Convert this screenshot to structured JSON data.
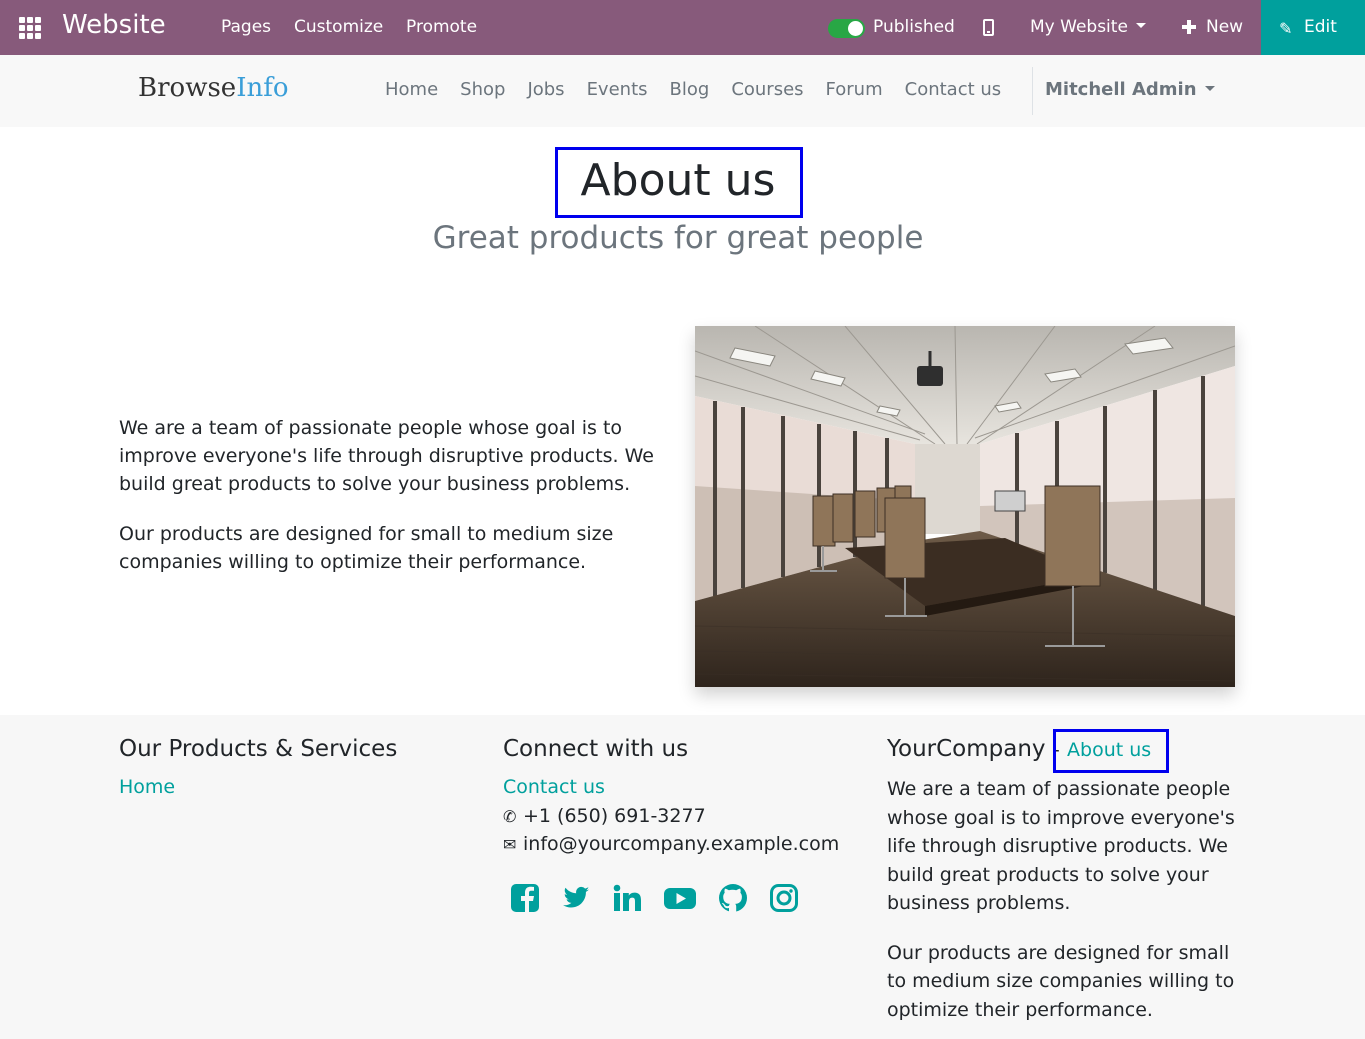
{
  "topbar": {
    "app_name": "Website",
    "menu": [
      "Pages",
      "Customize",
      "Promote"
    ],
    "published_label": "Published",
    "published_on": true,
    "website_selector": "My Website",
    "new_label": "New",
    "edit_label": "Edit",
    "colors": {
      "bar": "#875a7b",
      "edit": "#00a09d",
      "toggle": "#28a745"
    }
  },
  "header": {
    "logo_part1": "Browse",
    "logo_part2": "Info",
    "nav": [
      "Home",
      "Shop",
      "Jobs",
      "Events",
      "Blog",
      "Courses",
      "Forum",
      "Contact us"
    ],
    "user": "Mitchell Admin"
  },
  "page": {
    "title": "About us",
    "subtitle": "Great products for great people",
    "paragraph1": "We are a team of passionate people whose goal is to improve everyone's life through disruptive products. We build great products to solve your business problems.",
    "paragraph2": "Our products are designed for small to medium size companies willing to optimize their performance."
  },
  "footer": {
    "col1_title": "Our Products & Services",
    "col1_link": "Home",
    "col2_title": "Connect with us",
    "contact_link": "Contact us",
    "phone": "+1 (650) 691-3277",
    "email": "info@yourcompany.example.com",
    "social_icons": [
      "facebook-icon",
      "twitter-icon",
      "linkedin-icon",
      "youtube-icon",
      "github-icon",
      "instagram-icon"
    ],
    "col3_title": "YourCompany",
    "col3_dash": "-",
    "col3_link": "About us",
    "about_p1": "We are a team of passionate people whose goal is to improve everyone's life through disruptive products. We build great products to solve your business problems.",
    "about_p2": "Our products are designed for small to medium size companies willing to optimize their performance.",
    "link_color": "#00a09d"
  }
}
